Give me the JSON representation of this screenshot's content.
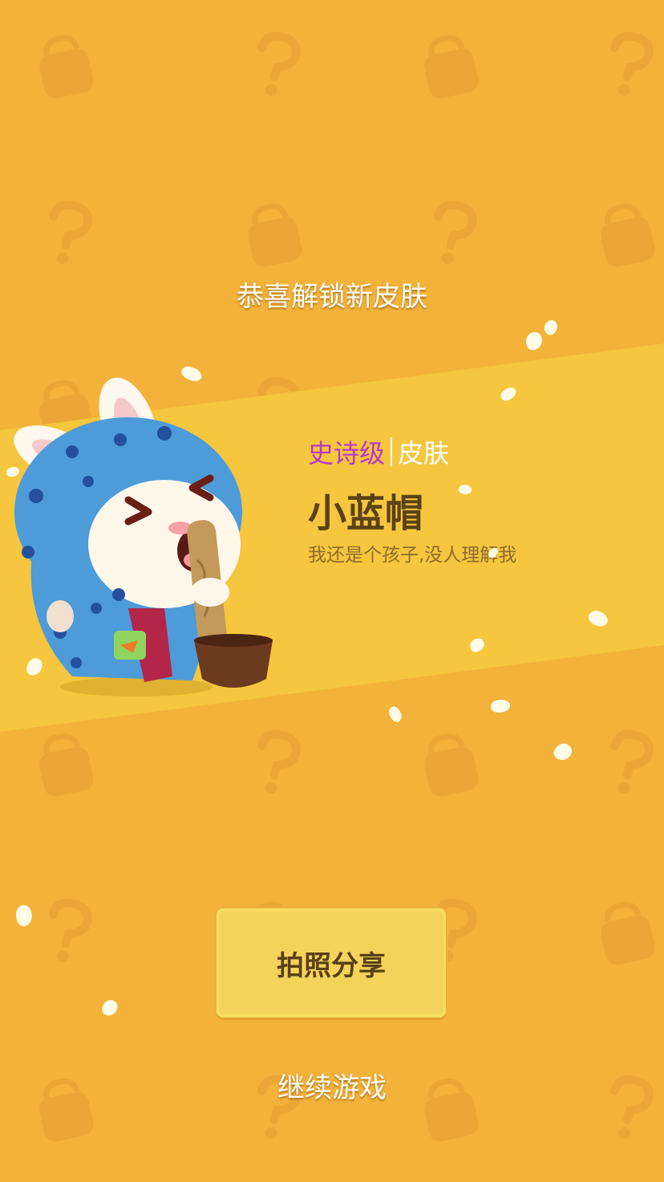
{
  "colors": {
    "background": "#f3b23a",
    "band": "#f5c63e",
    "rarity_accent": "#b63ac8",
    "title_text": "#5b4214",
    "button_fill": "#f4d35a"
  },
  "icons": {
    "background_pattern": [
      "shopping-bag-icon",
      "question-mark-icon"
    ],
    "character": "rabbit-blue-hood-illustration",
    "confetti": "petal-icon"
  },
  "unlock": {
    "headline": "恭喜解锁新皮肤",
    "rarity": "史诗级",
    "category": "皮肤",
    "name": "小蓝帽",
    "description": "我还是个孩子,没人理解我"
  },
  "actions": {
    "share_label": "拍照分享",
    "continue_label": "继续游戏"
  }
}
